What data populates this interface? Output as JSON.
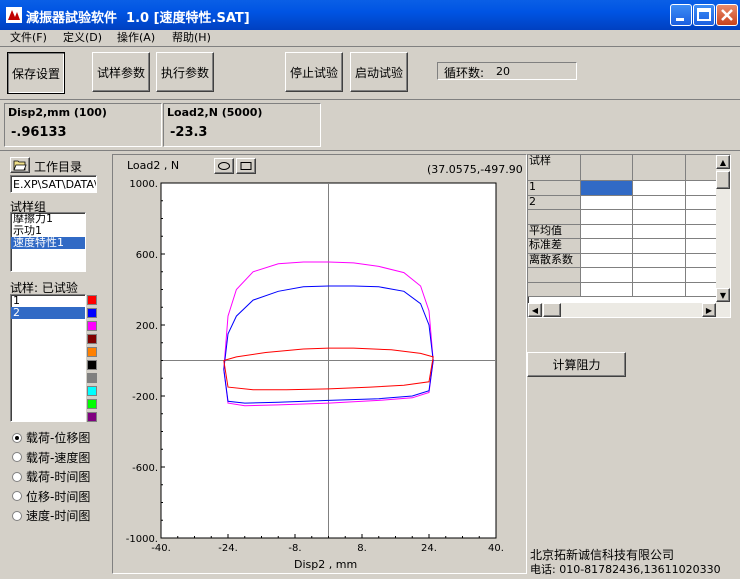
{
  "window": {
    "title": "減振器試验软件  1.0 [速度特性.SAT]"
  },
  "menu": [
    {
      "label": "文件(F)"
    },
    {
      "label": "定义(D)"
    },
    {
      "label": "操作(A)"
    },
    {
      "label": "帮助(H)"
    }
  ],
  "toolbar": {
    "save_settings": "保存设置",
    "sample_params": "试样参数",
    "exec_params": "执行参数",
    "stop_test": "停止试验",
    "start_test": "启动试验",
    "cycle_label": "循环数:",
    "cycle_value": "20"
  },
  "readouts": [
    {
      "label": "Disp2,mm (100)",
      "value": "-.96133"
    },
    {
      "label": "Load2,N (5000)",
      "value": "-23.3"
    }
  ],
  "left": {
    "workdir_label": "工作目录",
    "workdir_path": "E.XP\\SAT\\DATA\\",
    "group_label": "试样组",
    "groups": [
      "摩擦力1",
      "示功1",
      "速度特性1"
    ],
    "selected_group": 2,
    "samples_label": "试样: 已试验",
    "samples": [
      "1",
      "2"
    ],
    "selected_sample": 1,
    "swatch_colors": [
      "#ff0000",
      "#0000ff",
      "#ff00ff",
      "#800000",
      "#ff8000",
      "#000000",
      "#808080",
      "#00ffff",
      "#00ff00",
      "#800080"
    ],
    "plot_modes": [
      "载荷-位移图",
      "载荷-速度图",
      "载荷-时间图",
      "位移-时间图",
      "速度-时间图"
    ],
    "selected_mode": 0
  },
  "plot": {
    "ylabel": "Load2 , N",
    "xlabel": "Disp2 , mm",
    "coord_readout": "(37.0575,-497.90",
    "yticks": [
      "1000.",
      "600.",
      "200.",
      "-200.",
      "-600.",
      "-1000."
    ],
    "xticks": [
      "-40.",
      "-24.",
      "-8.",
      "8.",
      "24.",
      "40."
    ]
  },
  "chart_data": {
    "type": "line",
    "xlabel": "Disp2 , mm",
    "ylabel": "Load2 , N",
    "xlim": [
      -40,
      40
    ],
    "ylim": [
      -1000,
      1000
    ],
    "grid": false,
    "series": [
      {
        "color": "#ff00ff",
        "upper": [
          [
            -25,
            -50
          ],
          [
            -24,
            250
          ],
          [
            -22,
            400
          ],
          [
            -18,
            500
          ],
          [
            -12,
            545
          ],
          [
            -6,
            555
          ],
          [
            0,
            555
          ],
          [
            6,
            550
          ],
          [
            12,
            530
          ],
          [
            18,
            495
          ],
          [
            22,
            420
          ],
          [
            24,
            280
          ],
          [
            25,
            0
          ]
        ],
        "lower": [
          [
            25,
            0
          ],
          [
            24,
            -180
          ],
          [
            20,
            -210
          ],
          [
            12,
            -225
          ],
          [
            0,
            -240
          ],
          [
            -12,
            -250
          ],
          [
            -20,
            -255
          ],
          [
            -24,
            -240
          ],
          [
            -25,
            -50
          ]
        ]
      },
      {
        "color": "#0000ff",
        "upper": [
          [
            -25,
            -50
          ],
          [
            -24,
            150
          ],
          [
            -22,
            250
          ],
          [
            -18,
            340
          ],
          [
            -12,
            390
          ],
          [
            -6,
            415
          ],
          [
            0,
            420
          ],
          [
            6,
            420
          ],
          [
            12,
            415
          ],
          [
            18,
            390
          ],
          [
            22,
            320
          ],
          [
            24,
            200
          ],
          [
            25,
            0
          ]
        ],
        "lower": [
          [
            25,
            0
          ],
          [
            24,
            -170
          ],
          [
            20,
            -200
          ],
          [
            12,
            -215
          ],
          [
            0,
            -225
          ],
          [
            -12,
            -235
          ],
          [
            -20,
            -240
          ],
          [
            -24,
            -230
          ],
          [
            -25,
            -50
          ]
        ]
      },
      {
        "color": "#ff0000",
        "upper": [
          [
            -25,
            0
          ],
          [
            -22,
            20
          ],
          [
            -15,
            45
          ],
          [
            -6,
            65
          ],
          [
            0,
            70
          ],
          [
            6,
            70
          ],
          [
            15,
            60
          ],
          [
            22,
            40
          ],
          [
            25,
            20
          ]
        ],
        "lower": [
          [
            25,
            20
          ],
          [
            24,
            -120
          ],
          [
            18,
            -140
          ],
          [
            10,
            -150
          ],
          [
            0,
            -160
          ],
          [
            -10,
            -165
          ],
          [
            -18,
            -165
          ],
          [
            -24,
            -150
          ],
          [
            -25,
            0
          ]
        ]
      }
    ]
  },
  "grid": {
    "header": "试样",
    "rows": [
      "1",
      "2",
      "",
      "平均值",
      "标准差",
      "离散系数",
      "",
      ""
    ]
  },
  "calc_button": "计算阻力",
  "footer": {
    "company": "北京拓新诚信科技有限公司",
    "phone": "电话: 010-81782436,13611020330"
  }
}
